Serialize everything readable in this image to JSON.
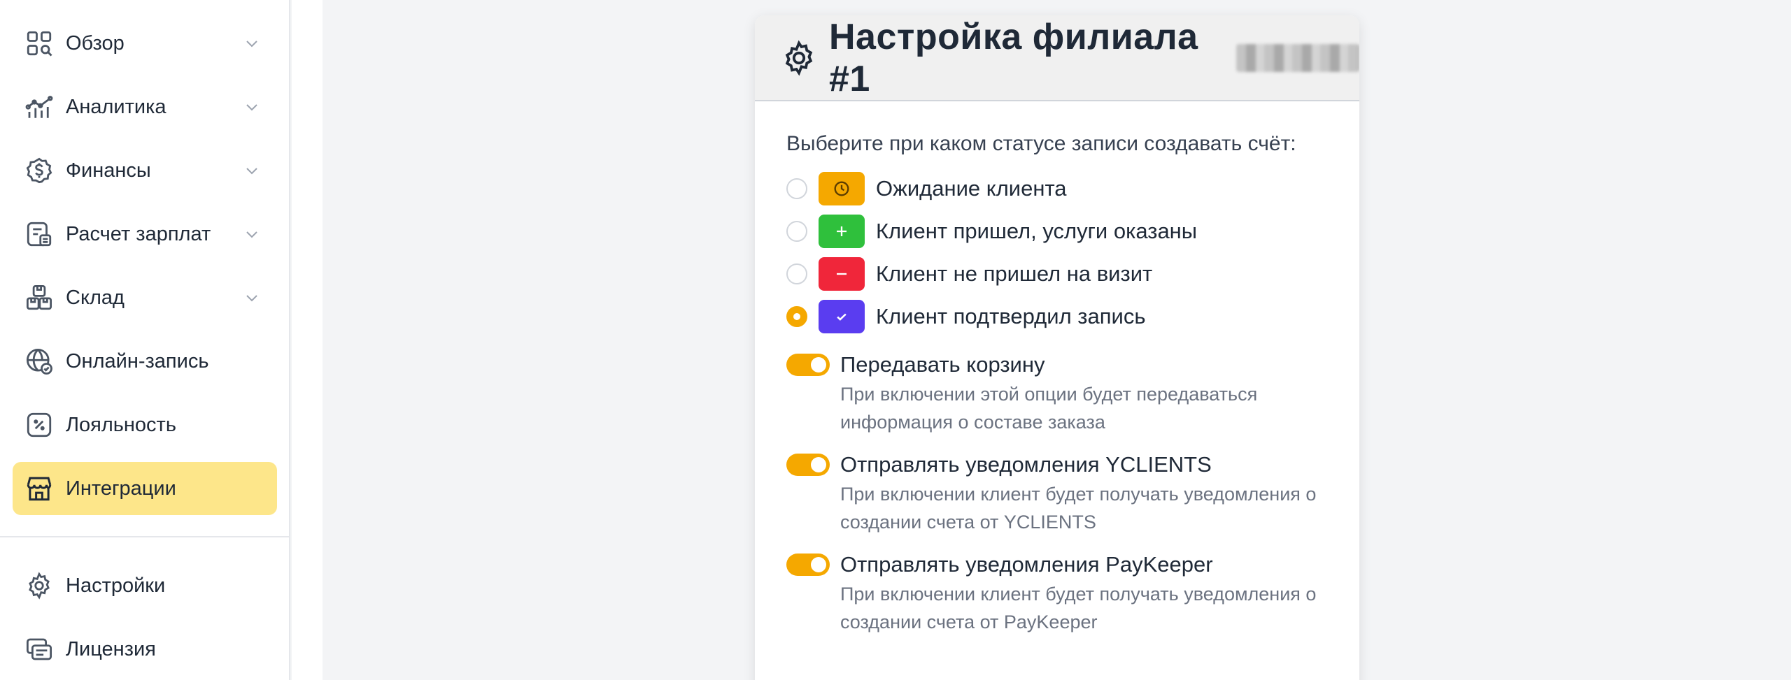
{
  "sidebar": {
    "items": [
      {
        "label": "Обзор",
        "icon": "overview-grid-icon",
        "has_chevron": true
      },
      {
        "label": "Аналитика",
        "icon": "analytics-chart-icon",
        "has_chevron": true
      },
      {
        "label": "Финансы",
        "icon": "finance-dollar-icon",
        "has_chevron": true
      },
      {
        "label": "Расчет зарплат",
        "icon": "payroll-icon",
        "has_chevron": true
      },
      {
        "label": "Склад",
        "icon": "warehouse-boxes-icon",
        "has_chevron": true
      },
      {
        "label": "Онлайн-запись",
        "icon": "globe-check-icon",
        "has_chevron": false
      },
      {
        "label": "Лояльность",
        "icon": "percent-icon",
        "has_chevron": false
      },
      {
        "label": "Интеграции",
        "icon": "store-icon",
        "has_chevron": false,
        "active": true
      }
    ],
    "bottom_items": [
      {
        "label": "Настройки",
        "icon": "gear-icon"
      },
      {
        "label": "Лицензия",
        "icon": "license-cards-icon"
      }
    ]
  },
  "card": {
    "title": "Настройка филиала #1",
    "prompt": "Выберите при каком статусе записи создавать счёт:",
    "statuses": [
      {
        "label": "Ожидание клиента",
        "icon": "clock-icon",
        "color": "#f5a800",
        "checked": false
      },
      {
        "label": "Клиент пришел, услуги оказаны",
        "icon": "plus-icon",
        "color": "#2fc03c",
        "checked": false
      },
      {
        "label": "Клиент не пришел на визит",
        "icon": "minus-icon",
        "color": "#f0263a",
        "checked": false
      },
      {
        "label": "Клиент подтвердил запись",
        "icon": "check-icon",
        "color": "#5a3df0",
        "checked": true
      }
    ],
    "toggles": [
      {
        "label": "Передавать корзину",
        "desc": "При включении этой опции будет передаваться информация о составе заказа",
        "on": true
      },
      {
        "label": "Отправлять уведомления YCLIENTS",
        "desc": "При включении клиент будет получать уведомления о создании счета от YCLIENTS",
        "on": true
      },
      {
        "label": "Отправлять уведомления PayKeeper",
        "desc": "При включении клиент будет получать уведомления о создании счета от PayKeeper",
        "on": true
      }
    ]
  },
  "colors": {
    "accent": "#f5a800",
    "active_nav": "#fde68a"
  }
}
